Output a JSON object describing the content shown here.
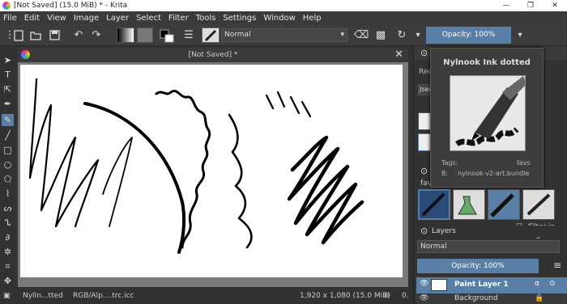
{
  "window": {
    "title": "[Not Saved]  (15.0 MiB)  * - Krita",
    "minimize": "—",
    "maximize": "❐",
    "close": "✕"
  },
  "menu": [
    "File",
    "Edit",
    "View",
    "Image",
    "Layer",
    "Select",
    "Filter",
    "Tools",
    "Settings",
    "Window",
    "Help"
  ],
  "toolbar": {
    "blend_mode": "Normal",
    "opacity": "Opacity: 100%"
  },
  "document": {
    "tab_title": "[Not Saved]  *",
    "close": "✕"
  },
  "status": {
    "brush": "NylIn...tted",
    "color_profile": "RGB/Alp....trc.icc",
    "dimensions": "1,920 x 1,080 (15.0 MiB)",
    "zoom": "0."
  },
  "tooltip": {
    "title": "Nylnook Ink dotted",
    "tags_label": "Tags:",
    "tags_value": "favs",
    "bundle_number": "8:",
    "bundle_name": "nylnook-v2-art.bundle"
  },
  "dock": {
    "recent_label": "Reco",
    "user_label": "Jsen",
    "tag_label": "favs",
    "filter_in_tag": "Filter in Tag",
    "layers_title": "Layers",
    "layers_blend": "Normal",
    "layers_opacity": "Opacity:  100%",
    "layers": [
      {
        "name": "Paint Layer 1"
      },
      {
        "name": "Background"
      }
    ]
  },
  "colors": {
    "accent": "#5a7fa6",
    "panel": "#323232",
    "canvas": "#ffffff"
  }
}
